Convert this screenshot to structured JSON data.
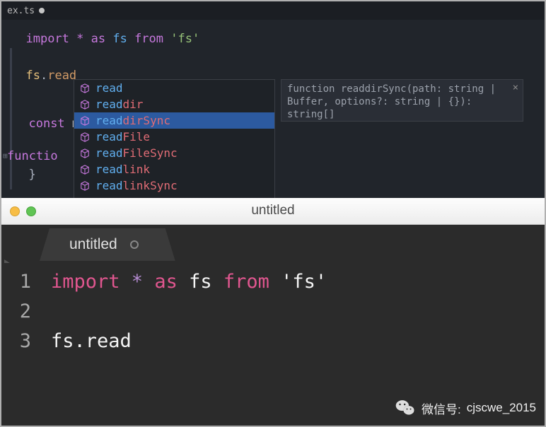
{
  "top": {
    "tab_label": "ex.ts",
    "code_line_1": [
      {
        "t": "import ",
        "c": "tok-keyword"
      },
      {
        "t": "* ",
        "c": "tok-keyword"
      },
      {
        "t": "as ",
        "c": "tok-keyword"
      },
      {
        "t": "fs ",
        "c": "tok-mod"
      },
      {
        "t": "from ",
        "c": "tok-keyword"
      },
      {
        "t": "'fs'",
        "c": "tok-string"
      }
    ],
    "code_line_2": [
      {
        "t": "fs",
        "c": "tok-obj"
      },
      {
        "t": ".",
        "c": "tok-punct"
      },
      {
        "t": "read",
        "c": "tok-plain"
      }
    ],
    "bg_line_3": [
      {
        "t": "const ",
        "c": "tok-keyword"
      },
      {
        "t": "m",
        "c": "tok-punct"
      }
    ],
    "bg_line_4": [
      {
        "t": "functio",
        "c": "tok-keyword"
      }
    ],
    "bg_line_5": [
      {
        "t": "}",
        "c": "tok-punct"
      }
    ],
    "suggestions": [
      {
        "prefix": "read",
        "rest": "",
        "selected": false
      },
      {
        "prefix": "read",
        "rest": "dir",
        "selected": false
      },
      {
        "prefix": "read",
        "rest": "dirSync",
        "selected": true
      },
      {
        "prefix": "read",
        "rest": "File",
        "selected": false
      },
      {
        "prefix": "read",
        "rest": "FileSync",
        "selected": false
      },
      {
        "prefix": "read",
        "rest": "link",
        "selected": false
      },
      {
        "prefix": "read",
        "rest": "linkSync",
        "selected": false
      }
    ],
    "doc_text": "function readdirSync(path: string | Buffer, options?: string | {}): string[]"
  },
  "bottom": {
    "window_title": "untitled",
    "tab_label": "untitled",
    "lines": [
      {
        "n": "1",
        "tokens": [
          {
            "t": "import ",
            "c": "tk-kw"
          },
          {
            "t": "* ",
            "c": "tk-star"
          },
          {
            "t": "as ",
            "c": "tk-kw"
          },
          {
            "t": "fs ",
            "c": "tk-id"
          },
          {
            "t": "from ",
            "c": "tk-kw"
          },
          {
            "t": "'fs'",
            "c": "tk-str"
          }
        ]
      },
      {
        "n": "2",
        "tokens": []
      },
      {
        "n": "3",
        "tokens": [
          {
            "t": "fs.read",
            "c": "tk-id"
          }
        ]
      }
    ]
  },
  "watermark": {
    "prefix": "微信号:",
    "id": "cjscwe_2015"
  }
}
